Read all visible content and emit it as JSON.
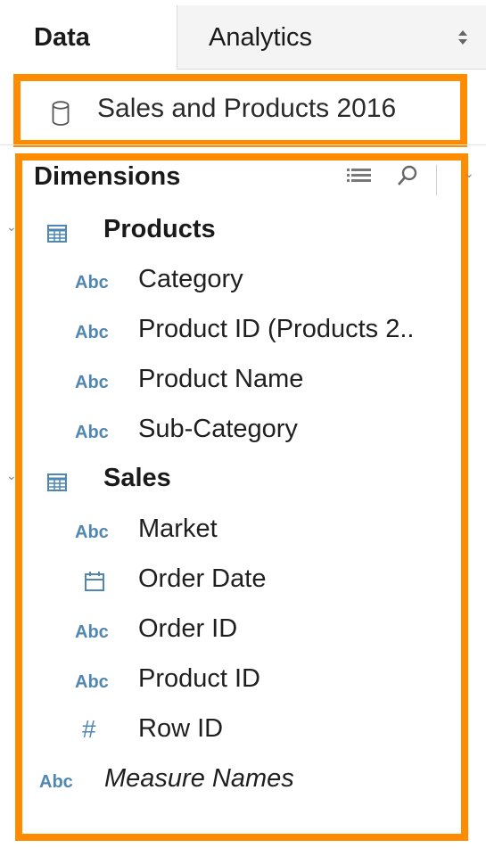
{
  "tabs": {
    "data_label": "Data",
    "analytics_label": "Analytics"
  },
  "datasource": {
    "name": "Sales and Products 2016",
    "icon": "database-icon"
  },
  "dimensions": {
    "title": "Dimensions",
    "groups": [
      {
        "label": "Products",
        "icon": "table-icon",
        "fields": [
          {
            "type": "Abc",
            "label": "Category"
          },
          {
            "type": "Abc",
            "label": "Product ID (Products 2.."
          },
          {
            "type": "Abc",
            "label": "Product Name"
          },
          {
            "type": "Abc",
            "label": "Sub-Category"
          }
        ]
      },
      {
        "label": "Sales",
        "icon": "table-icon",
        "fields": [
          {
            "type": "Abc",
            "label": "Market"
          },
          {
            "type": "date",
            "label": "Order Date"
          },
          {
            "type": "Abc",
            "label": "Order ID"
          },
          {
            "type": "Abc",
            "label": "Product ID"
          },
          {
            "type": "#",
            "label": "Row ID"
          }
        ]
      }
    ],
    "root_fields": [
      {
        "type": "Abc",
        "label": "Measure Names"
      }
    ]
  },
  "colors": {
    "highlight": "#ff8c00",
    "type_icon": "#4f87b2"
  }
}
